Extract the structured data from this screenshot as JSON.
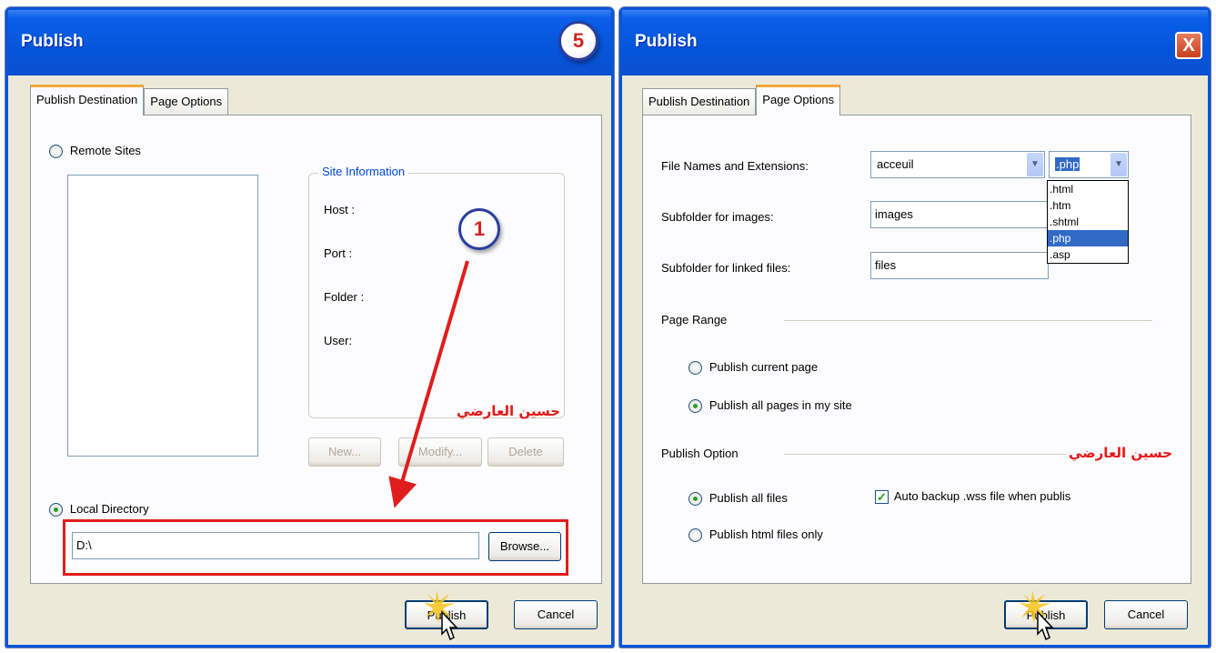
{
  "left_dialog": {
    "title": "Publish",
    "step_badge": "5",
    "tabs": [
      "Publish Destination",
      "Page Options"
    ],
    "remote_sites_label": "Remote Sites",
    "site_info": {
      "title": "Site Information",
      "host": "Host :",
      "port": "Port :",
      "folder": "Folder :",
      "user": "User:"
    },
    "annotation_step": "1",
    "watermark": "حسين العارضي",
    "buttons": {
      "new": "New...",
      "modify": "Modify...",
      "delete": "Delete"
    },
    "local_directory_label": "Local Directory",
    "local_directory_value": "D:\\",
    "browse": "Browse...",
    "publish": "Publish",
    "cancel": "Cancel"
  },
  "right_dialog": {
    "title": "Publish",
    "close": "X",
    "tabs": [
      "Publish Destination",
      "Page Options"
    ],
    "file_names_label": "File Names and Extensions:",
    "file_name_value": "acceuil",
    "extension_value": ".php",
    "extension_options": [
      ".html",
      ".htm",
      ".shtml",
      ".php",
      ".asp"
    ],
    "subfolder_images_label": "Subfolder for images:",
    "subfolder_images_value": "images",
    "subfolder_files_label": "Subfolder for linked files:",
    "subfolder_files_value": "files",
    "page_range_label": "Page Range",
    "publish_current": "Publish current page",
    "publish_all_pages": "Publish all pages in my site",
    "publish_option_label": "Publish Option",
    "watermark": "حسين العارضي",
    "publish_all_files": "Publish all files",
    "publish_html_only": "Publish html files only",
    "auto_backup": "Auto backup .wss file when publis",
    "publish": "Publish",
    "cancel": "Cancel"
  },
  "colors": {
    "title_bar": "#0555da",
    "dialog_bg": "#ece9d8",
    "highlight_red": "#e31717",
    "selected_item": "#316ac5"
  }
}
